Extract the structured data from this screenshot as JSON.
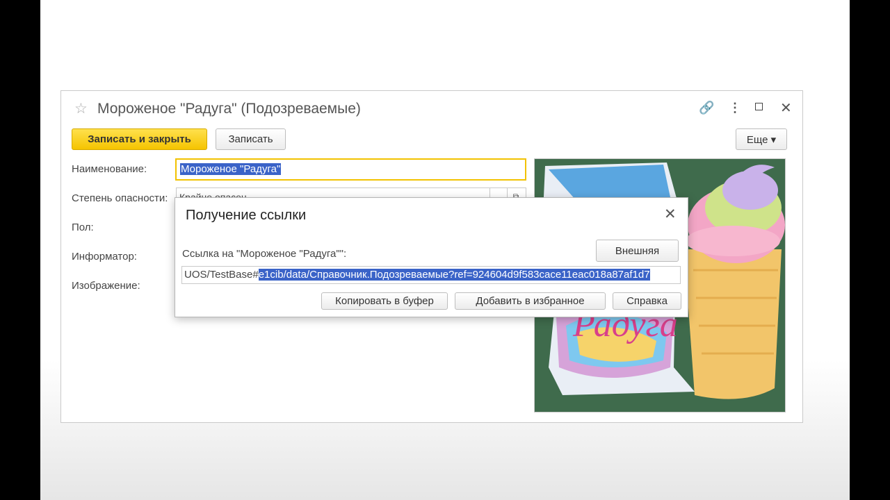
{
  "window": {
    "title": "Мороженое \"Радуга\" (Подозреваемые)",
    "toolbar": {
      "save_close_label": "Записать и закрыть",
      "save_label": "Записать",
      "more_label": "Еще ▾"
    },
    "fields": {
      "name_label": "Наименование:",
      "name_value": "Мороженое \"Радуга\"",
      "danger_label": "Степень опасности:",
      "danger_value": "Крайне опасен",
      "gender_label": "Пол:",
      "informant_label": "Информатор:",
      "image_label": "Изображение:"
    }
  },
  "dialog": {
    "title": "Получение ссылки",
    "link_label": "Ссылка на \"Мороженое \"Радуга\"\":",
    "external_button": "Внешняя",
    "url_prefix": "UOS/TestBase#",
    "url_selected": "e1cib/data/Справочник.Подозреваемые?ref=924604d9f583cace11eac018a87af1d7",
    "copy_button": "Копировать в буфер",
    "favorite_button": "Добавить в избранное",
    "help_button": "Справка"
  },
  "colors": {
    "primary": "#f5c400",
    "selection": "#3a63c8",
    "picture_bg": "#3f6b4c"
  },
  "icons": [
    "star-icon",
    "link-icon",
    "more-vertical-icon",
    "maximize-icon",
    "close-icon"
  ]
}
